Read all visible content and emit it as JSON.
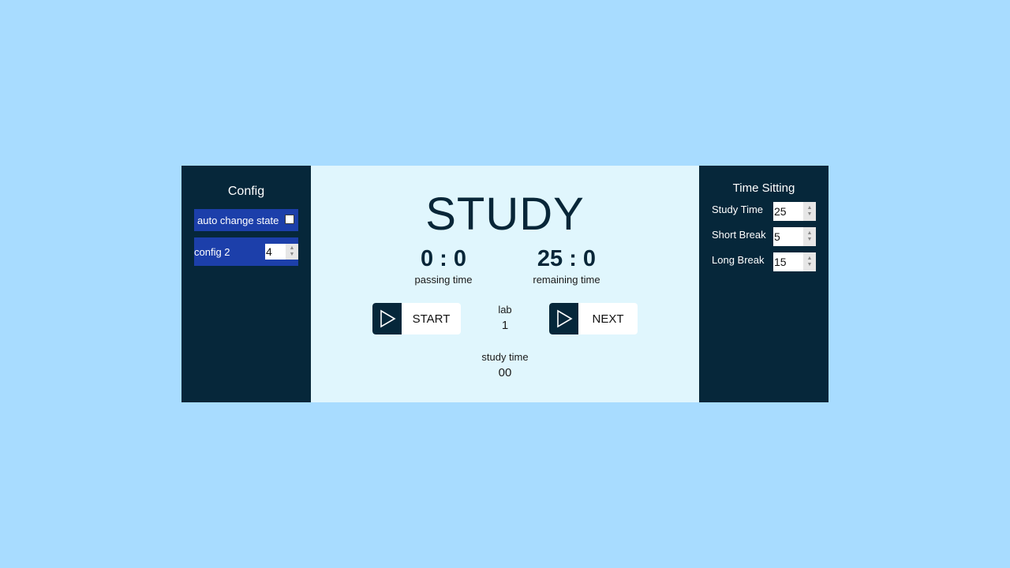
{
  "config": {
    "title": "Config",
    "auto_change_label": "auto change state",
    "auto_change_checked": false,
    "config2_label": "config 2",
    "config2_value": "4"
  },
  "main": {
    "state": "STUDY",
    "passing": {
      "value": "0 : 0",
      "label": "passing time"
    },
    "remaining": {
      "value": "25 : 0",
      "label": "remaining time"
    },
    "start_button": {
      "label": "START",
      "icon": "play-icon"
    },
    "next_button": {
      "label": "NEXT",
      "icon": "play-icon"
    },
    "lab": {
      "label": "lab",
      "value": "1"
    },
    "study_time": {
      "label": "study time",
      "value": "00"
    }
  },
  "time_setting": {
    "title": "Time Sitting",
    "items": [
      {
        "label": "Study Time",
        "value": "25"
      },
      {
        "label": "Short Break",
        "value": "5"
      },
      {
        "label": "Long Break",
        "value": "15"
      }
    ]
  },
  "colors": {
    "background": "#a8dcff",
    "panel_dark": "#06273a",
    "config_row": "#1c3faa",
    "center_bg": "#e0f6fd"
  }
}
